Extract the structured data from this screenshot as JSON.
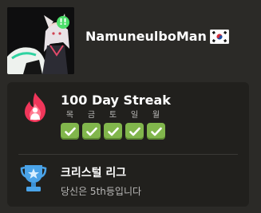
{
  "profile": {
    "username": "NamuneulboMan",
    "online_badge": "!!",
    "country_flag": "korea-flag-icon"
  },
  "streak": {
    "title": "100 Day Streak",
    "days": [
      {
        "label": "목",
        "completed": true
      },
      {
        "label": "금",
        "completed": true
      },
      {
        "label": "토",
        "completed": true
      },
      {
        "label": "일",
        "completed": true
      },
      {
        "label": "월",
        "completed": true
      }
    ],
    "icon": "flame-icon"
  },
  "league": {
    "title": "크리스털 리그",
    "subtitle": "당신은 5th등입니다",
    "icon": "crystal-trophy-icon"
  },
  "colors": {
    "background": "#2b2a27",
    "card": "#21201d",
    "check_green": "#81b64c",
    "flame": "#f0365a",
    "trophy": "#4aa3e8",
    "muted_text": "#bab9b8"
  }
}
